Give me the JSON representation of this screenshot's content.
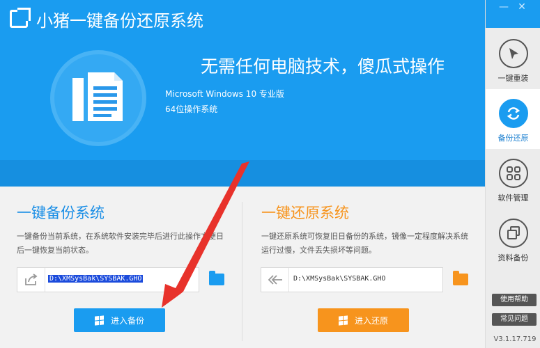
{
  "app": {
    "title": "小猪一键备份还原系统",
    "slogan": "无需任何电脑技术，傻瓜式操作",
    "os_name": "Microsoft Windows 10 专业版",
    "os_arch": "64位操作系统"
  },
  "window_controls": {
    "minimize": "—",
    "close": "✕"
  },
  "sidebar": {
    "items": [
      {
        "label": "一键重装",
        "icon": "cursor-icon"
      },
      {
        "label": "备份还原",
        "icon": "refresh-icon",
        "active": true
      },
      {
        "label": "软件管理",
        "icon": "grid-icon"
      },
      {
        "label": "资料备份",
        "icon": "copy-icon"
      }
    ],
    "help_label": "使用帮助",
    "faq_label": "常见问题",
    "version": "V3.1.17.719"
  },
  "backup": {
    "title": "一键备份系统",
    "desc": "一键备份当前系统，在系统软件安装完毕后进行此操作方便日后一键恢复当前状态。",
    "path": "D:\\XMSysBak\\SYSBAK.GHO",
    "button": "进入备份",
    "color": "#1a9cf0"
  },
  "restore": {
    "title": "一键还原系统",
    "desc": "一键还原系统可恢复旧日备份的系统，镜像一定程度解决系统运行过慢，文件丢失损坏等问题。",
    "path": "D:\\XMSysBak\\SYSBAK.GHO",
    "button": "进入还原",
    "color": "#f7941d"
  }
}
